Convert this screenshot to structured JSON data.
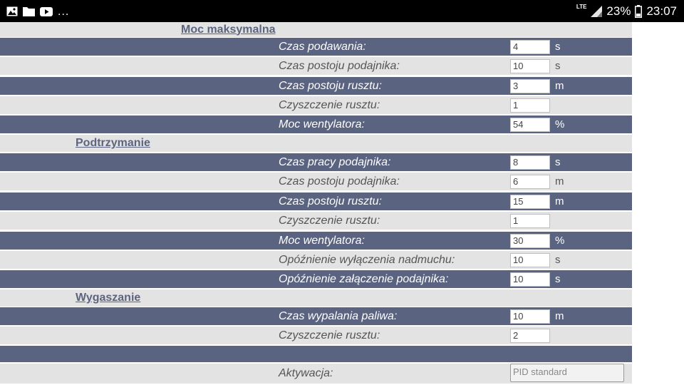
{
  "status_bar": {
    "icons": [
      "image-icon",
      "folder-icon",
      "youtube-icon"
    ],
    "more": "...",
    "network": "LTE",
    "battery_percent": "23%",
    "time": "23:07"
  },
  "sections": {
    "max": "Moc maksymalna",
    "hold": "Podtrzymanie",
    "off": "Wygaszanie"
  },
  "rows": [
    {
      "label": "Czas podawania:",
      "value": "4",
      "unit": "s"
    },
    {
      "label": "Czas postoju podajnika:",
      "value": "10",
      "unit": "s"
    },
    {
      "label": "Czas postoju rusztu:",
      "value": "3",
      "unit": "m"
    },
    {
      "label": "Czyszczenie rusztu:",
      "value": "1",
      "unit": ""
    },
    {
      "label": "Moc wentylatora:",
      "value": "54",
      "unit": "%"
    },
    {
      "label": "Czas pracy podajnika:",
      "value": "8",
      "unit": "s"
    },
    {
      "label": "Czas postoju podajnika:",
      "value": "6",
      "unit": "m"
    },
    {
      "label": "Czas postoju rusztu:",
      "value": "15",
      "unit": "m"
    },
    {
      "label": "Czyszczenie rusztu:",
      "value": "1",
      "unit": ""
    },
    {
      "label": "Moc wentylatora:",
      "value": "30",
      "unit": "%"
    },
    {
      "label": "Opóźnienie wyłączenia nadmuchu:",
      "value": "10",
      "unit": "s"
    },
    {
      "label": "Opóźnienie załączenie podajnika:",
      "value": "10",
      "unit": "s"
    },
    {
      "label": "Czas wypalania paliwa:",
      "value": "10",
      "unit": "m"
    },
    {
      "label": "Czyszczenie rusztu:",
      "value": "2",
      "unit": ""
    }
  ],
  "activation": {
    "label": "Aktywacja:",
    "value": "PID standard"
  },
  "colors": {
    "row_dark": "#5a6380",
    "row_light": "#e3e3e3",
    "section_text": "#5d6480"
  }
}
